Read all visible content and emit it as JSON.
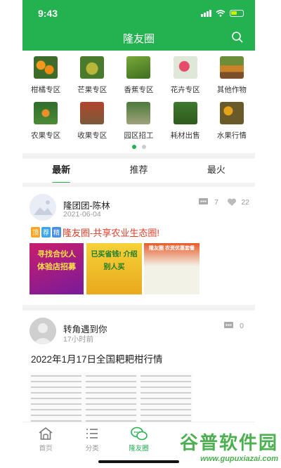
{
  "status_bar": {
    "time": "9:43"
  },
  "header": {
    "title": "隆友圈"
  },
  "categories": [
    {
      "label": "柑橘专区"
    },
    {
      "label": "芒果专区"
    },
    {
      "label": "香蕉专区"
    },
    {
      "label": "花卉专区"
    },
    {
      "label": "其他作物"
    },
    {
      "label": "农果专区"
    },
    {
      "label": "收果专区"
    },
    {
      "label": "园区招工"
    },
    {
      "label": "耗材出售"
    },
    {
      "label": "水果行情"
    }
  ],
  "tabs": [
    {
      "label": "最新"
    },
    {
      "label": "推荐"
    },
    {
      "label": "最火"
    }
  ],
  "posts": [
    {
      "user": "隆团团-陈林",
      "date": "2021-06-04",
      "comments": "7",
      "likes": "22",
      "tags": [
        "顶",
        "荐",
        "精"
      ],
      "headline": "隆友圈-共享农业生态圈!",
      "banners": [
        "寻找合伙人 体验店招募",
        "已买省钱! 介绍别人买",
        "隆友圈 农资优惠套餐"
      ]
    },
    {
      "user": "转角遇到你",
      "date": "17小时前",
      "comments": "0",
      "title": "2022年1月17日全国耙耙柑行情"
    }
  ],
  "tabbar": [
    {
      "label": "首页",
      "icon": "home-icon"
    },
    {
      "label": "分类",
      "icon": "list-icon"
    },
    {
      "label": "隆友圈",
      "icon": "chat-icon"
    }
  ],
  "watermark": {
    "text": "谷普软件园",
    "url": "www.gupuxiazai.com"
  },
  "colors": {
    "accent": "#24b14f",
    "highlight": "#e0402a"
  }
}
